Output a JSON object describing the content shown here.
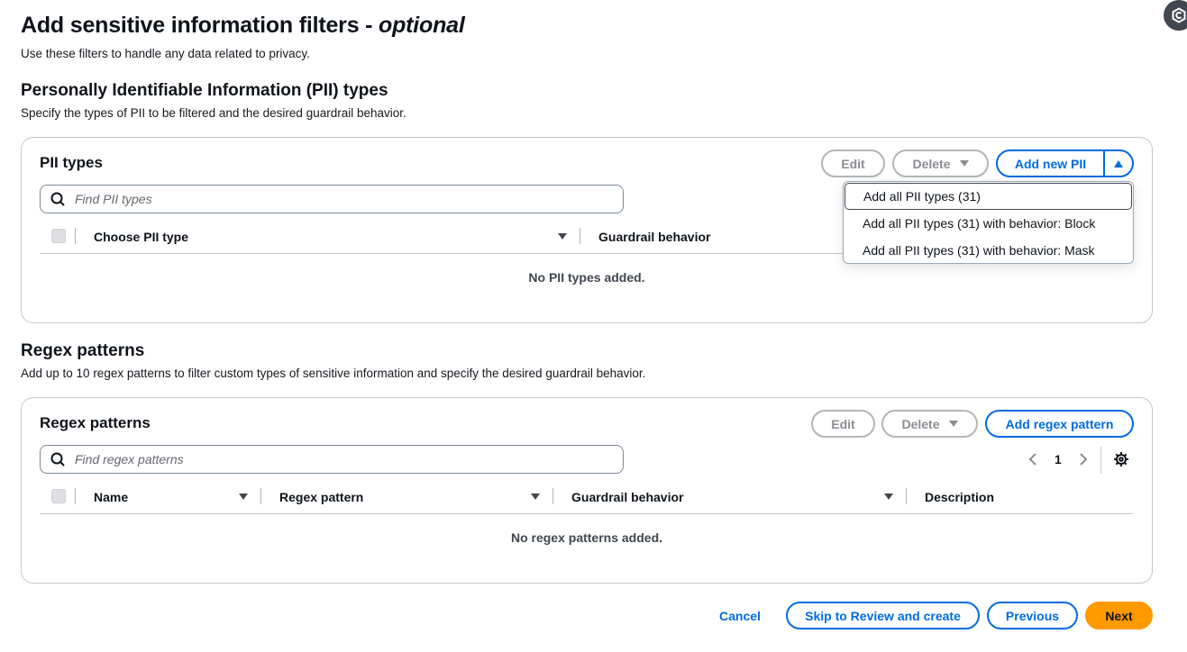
{
  "page": {
    "title_main": "Add sensitive information filters - ",
    "title_optional": "optional",
    "description": "Use these filters to handle any data related to privacy."
  },
  "pii_section": {
    "heading": "Personally Identifiable Information (PII) types",
    "description": "Specify the types of PII to be filtered and the desired guardrail behavior."
  },
  "pii_table": {
    "title": "PII types",
    "edit_label": "Edit",
    "delete_label": "Delete",
    "add_label": "Add new PII",
    "search_placeholder": "Find PII types",
    "columns": [
      "Choose PII type",
      "Guardrail behavior"
    ],
    "empty_text": "No PII types added.",
    "dropdown_items": [
      "Add all PII types (31)",
      "Add all PII types (31) with behavior: Block",
      "Add all PII types (31) with behavior: Mask"
    ]
  },
  "regex_section": {
    "heading": "Regex patterns",
    "description": "Add up to 10 regex patterns to filter custom types of sensitive information and specify the desired guardrail behavior."
  },
  "regex_table": {
    "title": "Regex patterns",
    "edit_label": "Edit",
    "delete_label": "Delete",
    "add_label": "Add regex pattern",
    "search_placeholder": "Find regex patterns",
    "page_number": "1",
    "columns": [
      "Name",
      "Regex pattern",
      "Guardrail behavior",
      "Description"
    ],
    "empty_text": "No regex patterns added."
  },
  "footer": {
    "cancel": "Cancel",
    "skip": "Skip to Review and create",
    "previous": "Previous",
    "next": "Next"
  },
  "icons": {
    "search": "search-icon",
    "settings": "gear-icon",
    "prev_page": "chevron-left-icon",
    "next_page": "chevron-right-icon",
    "avatar": "assistant-icon"
  },
  "colors": {
    "primary": "#006ce0",
    "accent": "#ff9900",
    "disabled": "#8c8c94"
  }
}
